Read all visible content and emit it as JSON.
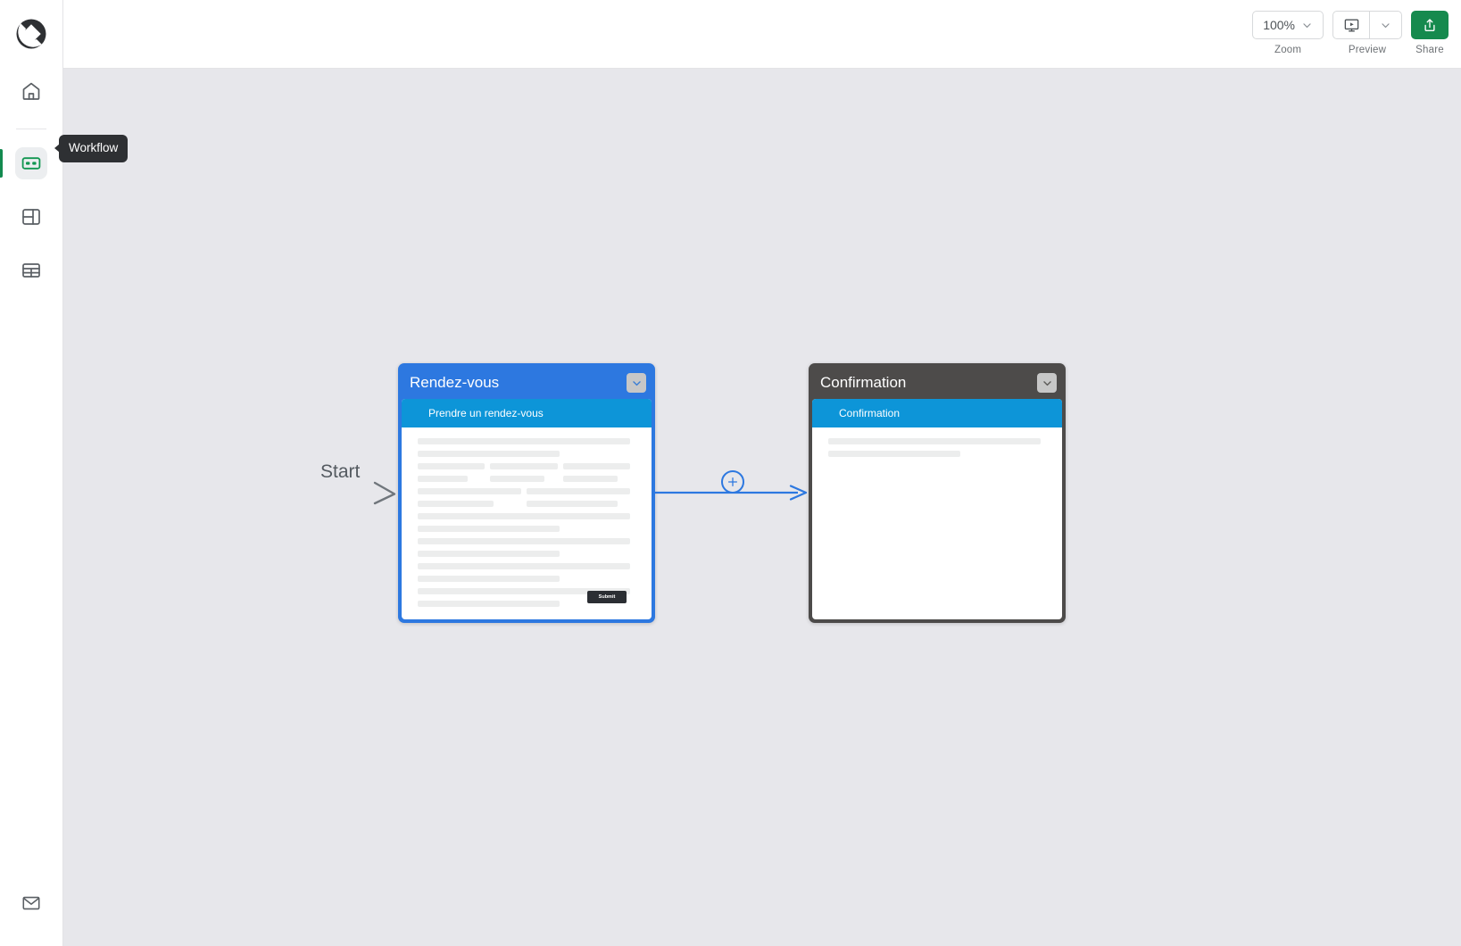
{
  "app": {
    "logo": "app-logo"
  },
  "sidebar": {
    "items": [
      {
        "id": "home",
        "icon": "home-icon",
        "label": "Home",
        "active": false
      },
      {
        "id": "workflow",
        "icon": "workflow-icon",
        "label": "Workflow",
        "active": true
      },
      {
        "id": "layout",
        "icon": "layout-icon",
        "label": "Layout",
        "active": false
      },
      {
        "id": "table",
        "icon": "table-icon",
        "label": "Table",
        "active": false
      }
    ],
    "bottom_item": {
      "id": "mail",
      "icon": "mail-icon",
      "label": "Mail"
    },
    "tooltip": "Workflow",
    "active_indicator_color": "#128a4f"
  },
  "toolbar": {
    "zoom": {
      "value": "100%",
      "caption": "Zoom",
      "caret_icon": "chevron-down-icon"
    },
    "preview": {
      "caption": "Preview",
      "icon": "monitor-play-icon",
      "caret_icon": "chevron-down-icon"
    },
    "share": {
      "caption": "Share",
      "icon": "share-upload-icon",
      "color": "#168a4e"
    }
  },
  "canvas": {
    "background": "#e7e7eb",
    "start": {
      "label": "Start",
      "arrow_color": "#8a8f94"
    },
    "connector": {
      "color": "#2d78e0",
      "add_icon": "plus-icon"
    },
    "nodes": [
      {
        "id": "rendez-vous",
        "title": "Rendez-vous",
        "header_color": "#2d78e0",
        "caret_icon": "chevron-down-icon",
        "screen": {
          "title": "Prendre un rendez-vous",
          "title_bar_color": "#0d95d8",
          "submit_label": "Submit",
          "submit_color": "#2b2e33"
        }
      },
      {
        "id": "confirmation",
        "title": "Confirmation",
        "header_color": "#4d4b4a",
        "caret_icon": "chevron-down-icon",
        "screen": {
          "title": "Confirmation",
          "title_bar_color": "#0d95d8",
          "submit_label": "",
          "submit_color": ""
        }
      }
    ]
  }
}
